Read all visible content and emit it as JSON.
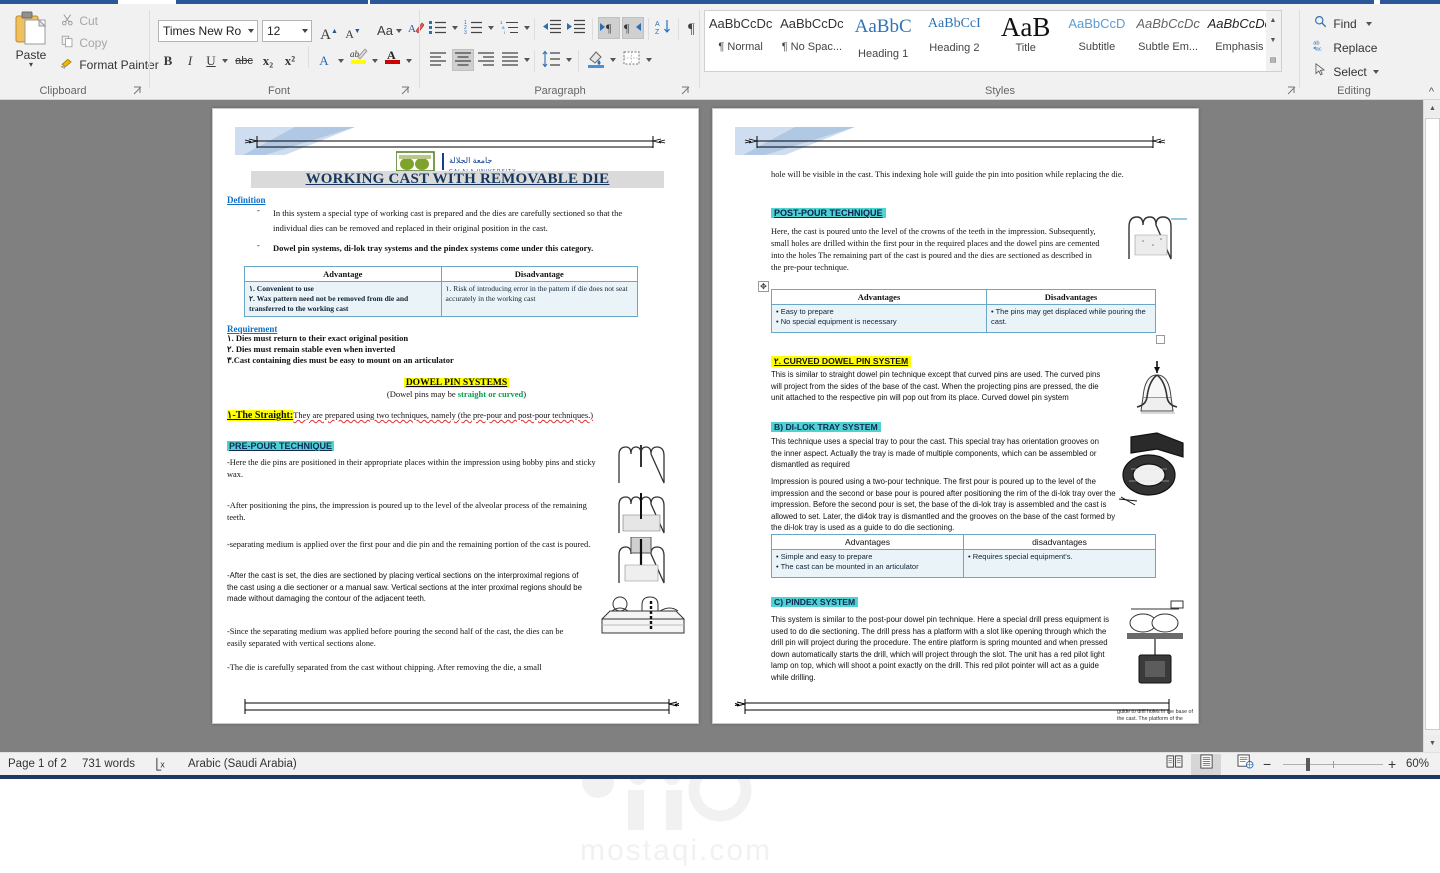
{
  "app": {
    "title": "Microsoft Word"
  },
  "ribbon": {
    "clipboard": {
      "group_label": "Clipboard",
      "paste_label": "Paste",
      "cut_label": "Cut",
      "copy_label": "Copy",
      "format_painter_label": "Format Painter"
    },
    "font": {
      "group_label": "Font",
      "font_name": "Times New Ro",
      "font_size": "12",
      "grow_label": "A",
      "shrink_label": "A",
      "change_case_label": "Aa",
      "clear_formatting_label": "A",
      "bold_label": "B",
      "italic_label": "I",
      "underline_label": "U",
      "strikethrough_label": "abc",
      "subscript_label": "x₂",
      "superscript_label": "x²",
      "text_effects_label": "A",
      "highlight_label": "ab",
      "font_color_label": "A"
    },
    "paragraph": {
      "group_label": "Paragraph"
    },
    "styles": {
      "group_label": "Styles",
      "items": [
        {
          "preview": "AaBbCcDc",
          "name": "¶ Normal"
        },
        {
          "preview": "AaBbCcDc",
          "name": "¶ No Spac..."
        },
        {
          "preview": "AaBbC",
          "name": "Heading 1"
        },
        {
          "preview": "AaBbCcI",
          "name": "Heading 2"
        },
        {
          "preview": "AaB",
          "name": "Title"
        },
        {
          "preview": "AaBbCcD",
          "name": "Subtitle"
        },
        {
          "preview": "AaBbCcDc",
          "name": "Subtle Em..."
        },
        {
          "preview": "AaBbCcDc",
          "name": "Emphasis"
        }
      ]
    },
    "editing": {
      "group_label": "Editing",
      "find_label": "Find",
      "replace_label": "Replace",
      "select_label": "Select"
    }
  },
  "document": {
    "university": {
      "ar": "جامعة الجلالة",
      "en": "GALALA UNIVERSITY"
    },
    "page_left": {
      "title": "WORKING CAST WITH REMOVABLE DIE",
      "definition_heading": "Definition",
      "definition_bullets": [
        "In this system a special type of working cast is prepared and the dies are carefully sectioned so that the individual dies can be removed and replaced in their original position in the cast.",
        "Dowel pin systems, di-lok tray systems and the pindex systems come under this category."
      ],
      "table1": {
        "headers": [
          "Advantage",
          "Disadvantage"
        ],
        "rows": [
          [
            "١. Convenient to use\n٢. Wax pattern need not be removed from die and transferred to the working cast",
            "١. Risk of introducing error in the pattern if die does not seat accurately in the working cast"
          ]
        ]
      },
      "requirement_heading": "Requirement",
      "requirements": [
        "١. Dies must return to their exact original position",
        "٢. Dies must remain stable even when inverted",
        "٣.Cast containing dies must be easy to mount on an articulator"
      ],
      "dowel_heading": "DOWEL PIN SYSTEMS",
      "dowel_sub_pre": "(Dowel pins may be ",
      "dowel_sub_green": "straight or curved",
      "dowel_sub_post": ")",
      "straight_heading": "١-The Straight:",
      "straight_text": "They are prepared using two techniques, namely (the pre-pour and post-pour techniques.)",
      "prepour_heading": "PRE-POUR TECHNIQUE",
      "prepour_paras": [
        "-Here the die pins are positioned in their appropriate places within the impression using bobby pins and sticky wax.",
        "-After positioning the pins, the impression is poured up to the level of the alveolar process of the remaining teeth.",
        "-separating medium is applied over the first pour and die pin and the remaining portion of the cast is poured.",
        "-After the cast is set, the dies are sectioned by placing vertical sections on the interproximal regions of the cast using a die sectioner or a manual saw. Vertical sections at the inter proximal regions should be made without damaging the contour of the adjacent teeth.",
        "-Since the separating medium was applied before pouring the second half of the cast, the dies can be easily separated with vertical sections alone.",
        "-The die is carefully separated from the cast without chipping. After removing the die, a small"
      ]
    },
    "page_right": {
      "continuation": "hole will be visible in the cast. This indexing hole will guide the pin into position while replacing the die.",
      "postpour_heading": "POST-POUR TECHNIQUE",
      "postpour_text": "Here, the cast is poured unto the level of the crowns of the teeth in the impression. Subsequently, small holes are drilled within the first pour in the required places and the dowel pins are cemented into the holes The remaining part of the cast is poured and the dies are sectioned as described in the pre-pour technique.",
      "table2": {
        "headers": [
          "Advantages",
          "Disadvantages"
        ],
        "rows": [
          [
            "• Easy to prepare\n• No special equipment is necessary",
            "• The pins may get displaced while pouring the cast."
          ]
        ]
      },
      "curved_heading": "٢. CURVED DOWEL PIN SYSTEM",
      "curved_text": "This is similar to straight dowel pin technique except that curved pins are used. The curved pins will project from the sides of the base of the cast. When the projecting pins are pressed, the die unit attached to the respective pin will pop out from its place. Curved dowel pin system",
      "dilok_heading": "B) DI-LOK TRAY SYSTEM",
      "dilok_paras": [
        "This technique uses a special tray to pour the cast. This special tray has orientation grooves on the inner aspect. Actually the tray is made of multiple components, which can be assembled or dismantled as required",
        "Impression is poured using a two-pour technique. The first pour is poured up to the level of the impression and the second or base pour is poured after positioning the rim of the di-lok tray over the impression. Before the second pour is set, the base of the di-lok tray is assembled and the cast is allowed to set. Later, the di4ok tray is dismantled and the grooves on the base of the cast formed by the di-lok tray is used as a guide to do die sectioning."
      ],
      "table3": {
        "headers": [
          "Advantages",
          "disadvantages"
        ],
        "rows": [
          [
            "• Simple and easy to prepare\n• The cast can be mounted in an articulator",
            "• Requires special equipment's."
          ]
        ]
      },
      "pindex_heading": "C) PINDEX SYSTEM",
      "pindex_text": "This system is similar to the post-pour dowel pin technique. Here a special drill press equipment is used to do die sectioning. The drill press has a platform with a slot like opening through which the drill pin will project during the procedure. The entire platform is spring mounted and when pressed down automatically starts the drill, which will project through the slot. The unit has a red pilot light lamp on top, which will shoot a point exactly on the drill. This red pilot pointer will act as a guide while drilling.",
      "figure_caption": "guide to drill holes in the base of the cast. The platform of the pindex machine is spring loaded. When the cast is passed against the the motor will get activated and drill a hole in the cast."
    }
  },
  "watermark": {
    "ar": "مستقل",
    "latin": "mostaqi.com"
  },
  "status": {
    "page_label": "Page 1 of 2",
    "words_label": "731 words",
    "proofing_label": "",
    "language_label": "Arabic (Saudi Arabia)",
    "zoom_label": "60%",
    "zoom_out_label": "−",
    "zoom_in_label": "+"
  },
  "colors": {
    "accent": "#2b579a",
    "highlight_yellow": "#ffff00",
    "highlight_cyan": "#4fd2d2",
    "heading_blue": "#17365d",
    "link_blue": "#0f6fc6",
    "table_border": "#6aa6c8",
    "table_fill": "#eaf4f8"
  }
}
